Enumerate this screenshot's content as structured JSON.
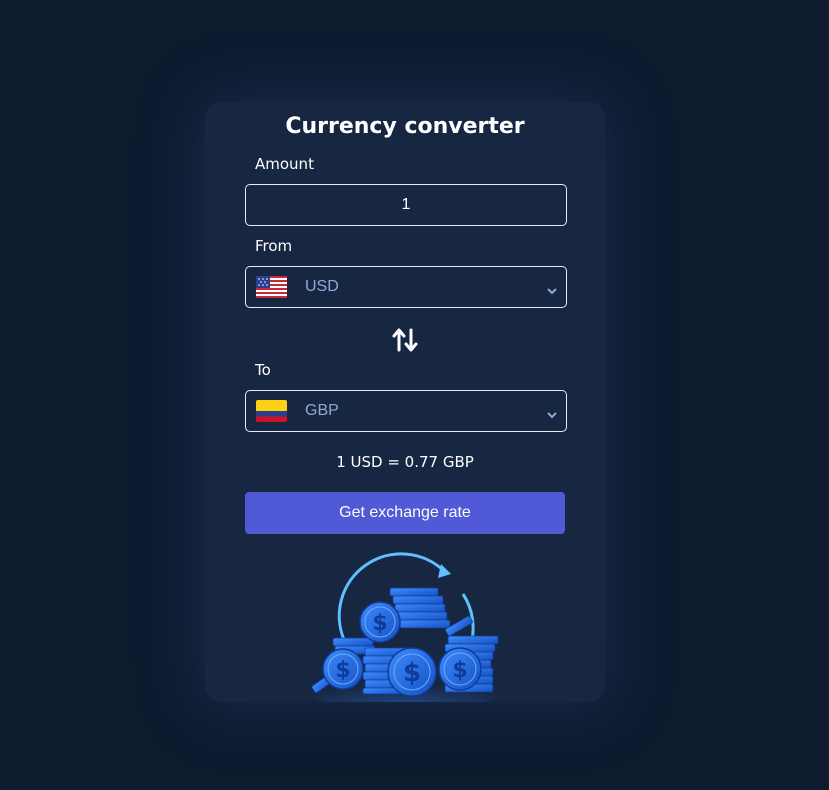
{
  "converter": {
    "title": "Currency converter",
    "amount_label": "Amount",
    "amount_value": "1",
    "from_label": "From",
    "from_currency": "USD",
    "from_flag_icon": "us-flag-icon",
    "to_label": "To",
    "to_currency": "GBP",
    "to_flag_icon": "colombia-flag-icon",
    "swap_icon": "swap-arrows-icon",
    "rate_text": "1 USD = 0.77 GBP",
    "button_label": "Get exchange rate",
    "illustration": "coins-exchange-illustration"
  },
  "colors": {
    "page_background": "#0e1a2e",
    "card_background": "#172742",
    "accent_button": "#5059d6",
    "select_text": "#8ea9d6",
    "coin_blue": "#1f6fe0"
  }
}
